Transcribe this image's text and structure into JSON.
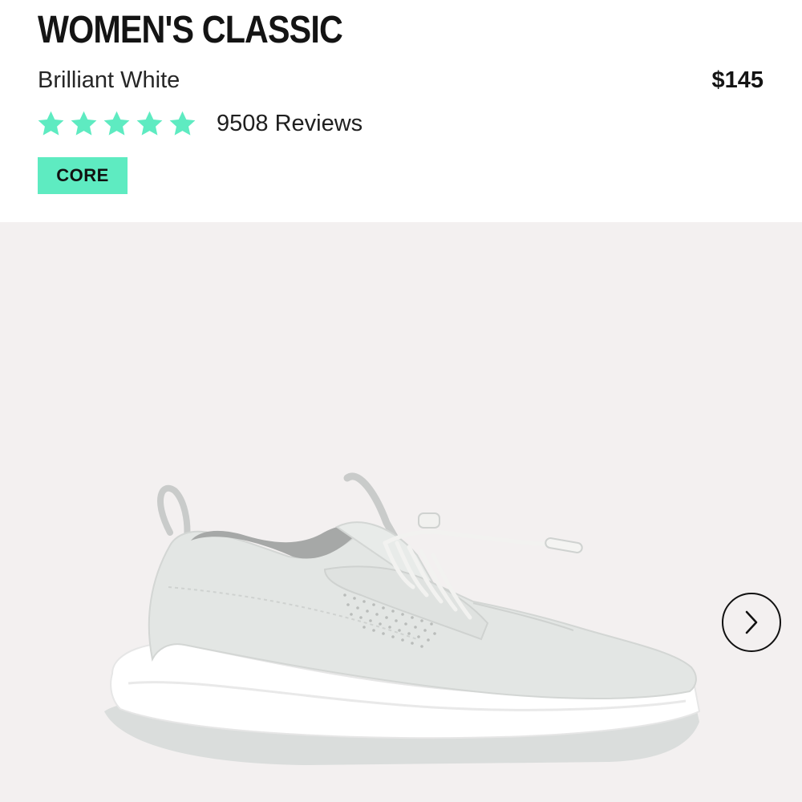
{
  "product": {
    "title": "WOMEN'S CLASSIC",
    "color_name": "Brilliant White",
    "price": "$145",
    "rating": {
      "stars_filled": 5,
      "stars_total": 5,
      "reviews_text": "9508 Reviews",
      "star_icon": "star-icon",
      "star_color": "#5eebc1"
    },
    "badge": {
      "label": "CORE",
      "color": "#5eebc1"
    }
  },
  "gallery": {
    "image_alt": "white sneaker",
    "background_color": "#f3f0f0",
    "next_icon": "chevron-right-icon"
  }
}
